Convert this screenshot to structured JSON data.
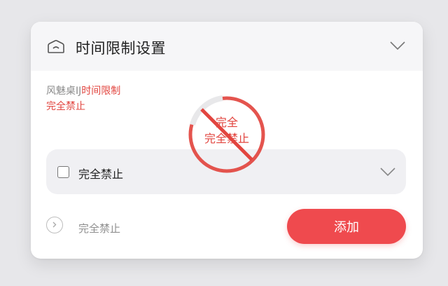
{
  "header": {
    "title": "时间限制设置",
    "icon": "router-icon",
    "collapse_icon": "chevron-down-icon"
  },
  "description": {
    "line1_prefix": "风魅桌IJ",
    "line1_accent": "时间限制",
    "line2": "完全禁止"
  },
  "dropdown": {
    "selected": "完全禁止",
    "icon": "chevron-down-icon"
  },
  "option": {
    "label": "完全禁止",
    "icon": "chevron-right-icon"
  },
  "add_button": {
    "label": "添加"
  },
  "stamp": {
    "line1": "完全",
    "line2": "完全禁止"
  },
  "colors": {
    "accent": "#e2453f",
    "button": "#ef4a4e",
    "background": "#e7e7ea",
    "card": "#ffffff"
  }
}
